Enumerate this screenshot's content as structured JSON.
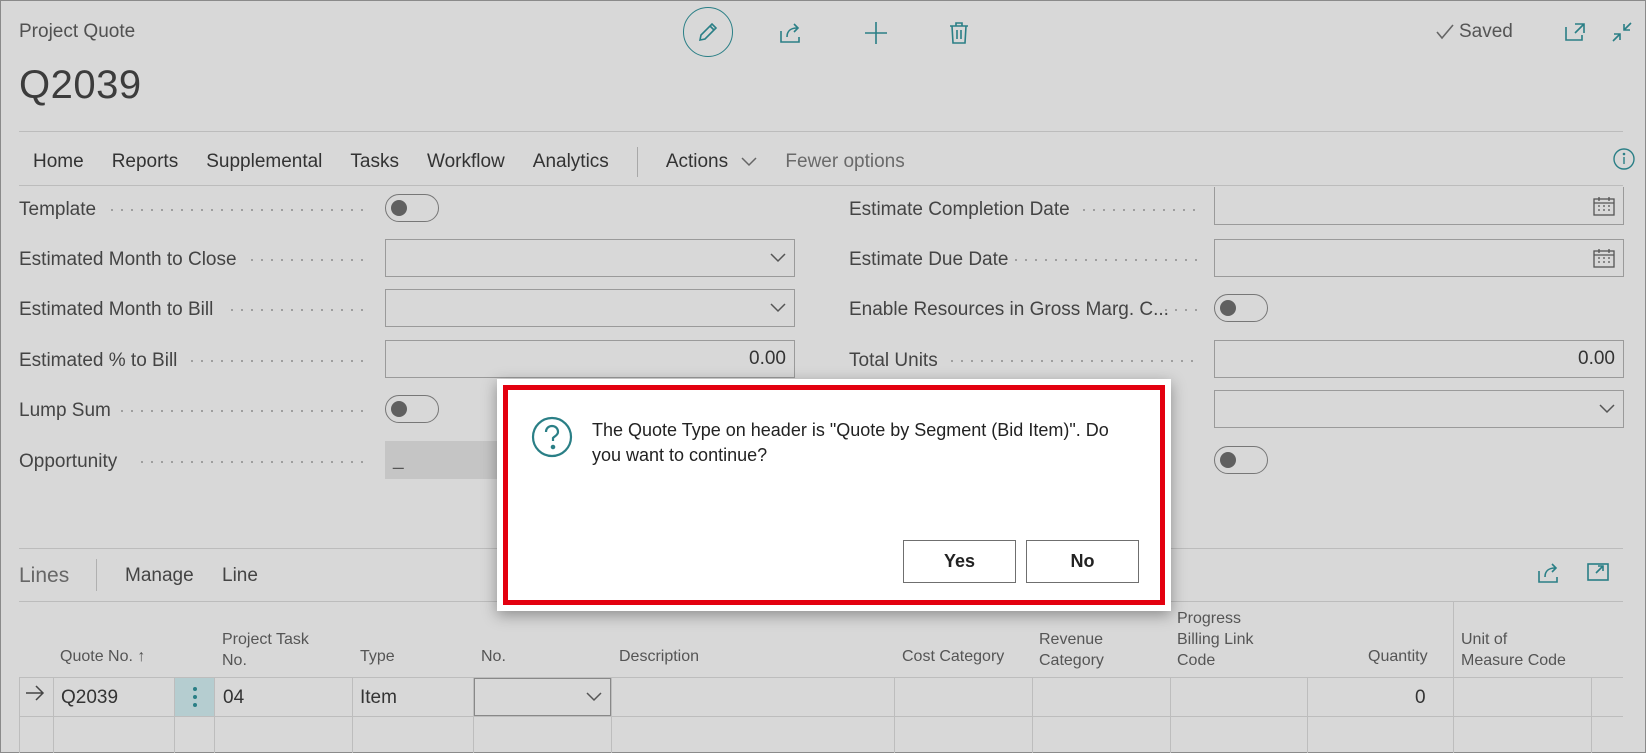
{
  "header": {
    "caption": "Project Quote",
    "title": "Q2039",
    "saved_label": "Saved"
  },
  "nav": {
    "items": [
      "Home",
      "Reports",
      "Supplemental",
      "Tasks",
      "Workflow",
      "Analytics"
    ],
    "actions_label": "Actions",
    "fewer_label": "Fewer options"
  },
  "fields": {
    "template": "Template",
    "est_month_close": "Estimated Month to Close",
    "est_month_bill": "Estimated Month to Bill",
    "est_pct_bill": "Estimated % to Bill",
    "est_pct_bill_value": "0.00",
    "lump_sum": "Lump Sum",
    "opportunity": "Opportunity",
    "opportunity_value": "_",
    "est_completion_date": "Estimate Completion Date",
    "est_due_date": "Estimate Due Date",
    "enable_resources": "Enable Resources in Gross Marg. C...",
    "total_units": "Total Units",
    "total_units_value": "0.00"
  },
  "lines": {
    "title": "Lines",
    "tab_manage": "Manage",
    "tab_line": "Line",
    "columns": {
      "quote_no": "Quote No. ↑",
      "project_task_no_1": "Project Task",
      "project_task_no_2": "No.",
      "type": "Type",
      "no": "No.",
      "description": "Description",
      "cost_category": "Cost Category",
      "revenue_category_1": "Revenue",
      "revenue_category_2": "Category",
      "progress_1": "Progress",
      "progress_2": "Billing Link",
      "progress_3": "Code",
      "quantity": "Quantity",
      "uom_1": "Unit of",
      "uom_2": "Measure Code"
    },
    "row": {
      "quote_no": "Q2039",
      "project_task_no": "04",
      "type": "Item",
      "quantity": "0"
    }
  },
  "dialog": {
    "message": "The Quote Type on header is \"Quote by Segment (Bid Item)\". Do you want to continue?",
    "yes_label": "Yes",
    "no_label": "No"
  },
  "colors": {
    "accent": "#2a7f86",
    "highlight_border": "#e3000f"
  }
}
